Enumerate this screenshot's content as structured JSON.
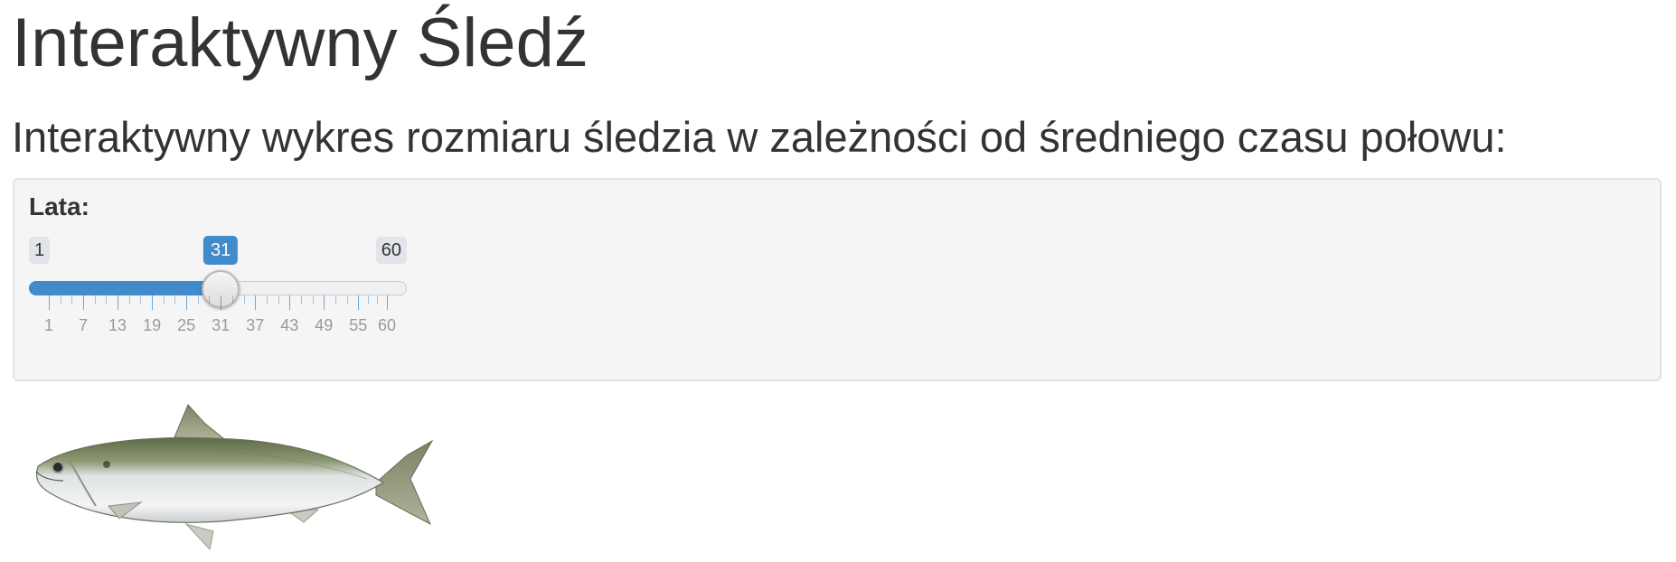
{
  "header": {
    "title": "Interaktywny Śledź",
    "subtitle": "Interaktywny wykres rozmiaru śledzia w zależności od średniego czasu połowu:"
  },
  "slider": {
    "label": "Lata:",
    "min": 1,
    "max": 60,
    "value": 31,
    "min_label": "1",
    "max_label": "60",
    "value_label": "31",
    "grid_labels": [
      "1",
      "7",
      "13",
      "19",
      "25",
      "31",
      "37",
      "43",
      "49",
      "55",
      "60"
    ],
    "accent_color": "#428bca"
  },
  "image": {
    "icon": "herring-fish-image"
  }
}
